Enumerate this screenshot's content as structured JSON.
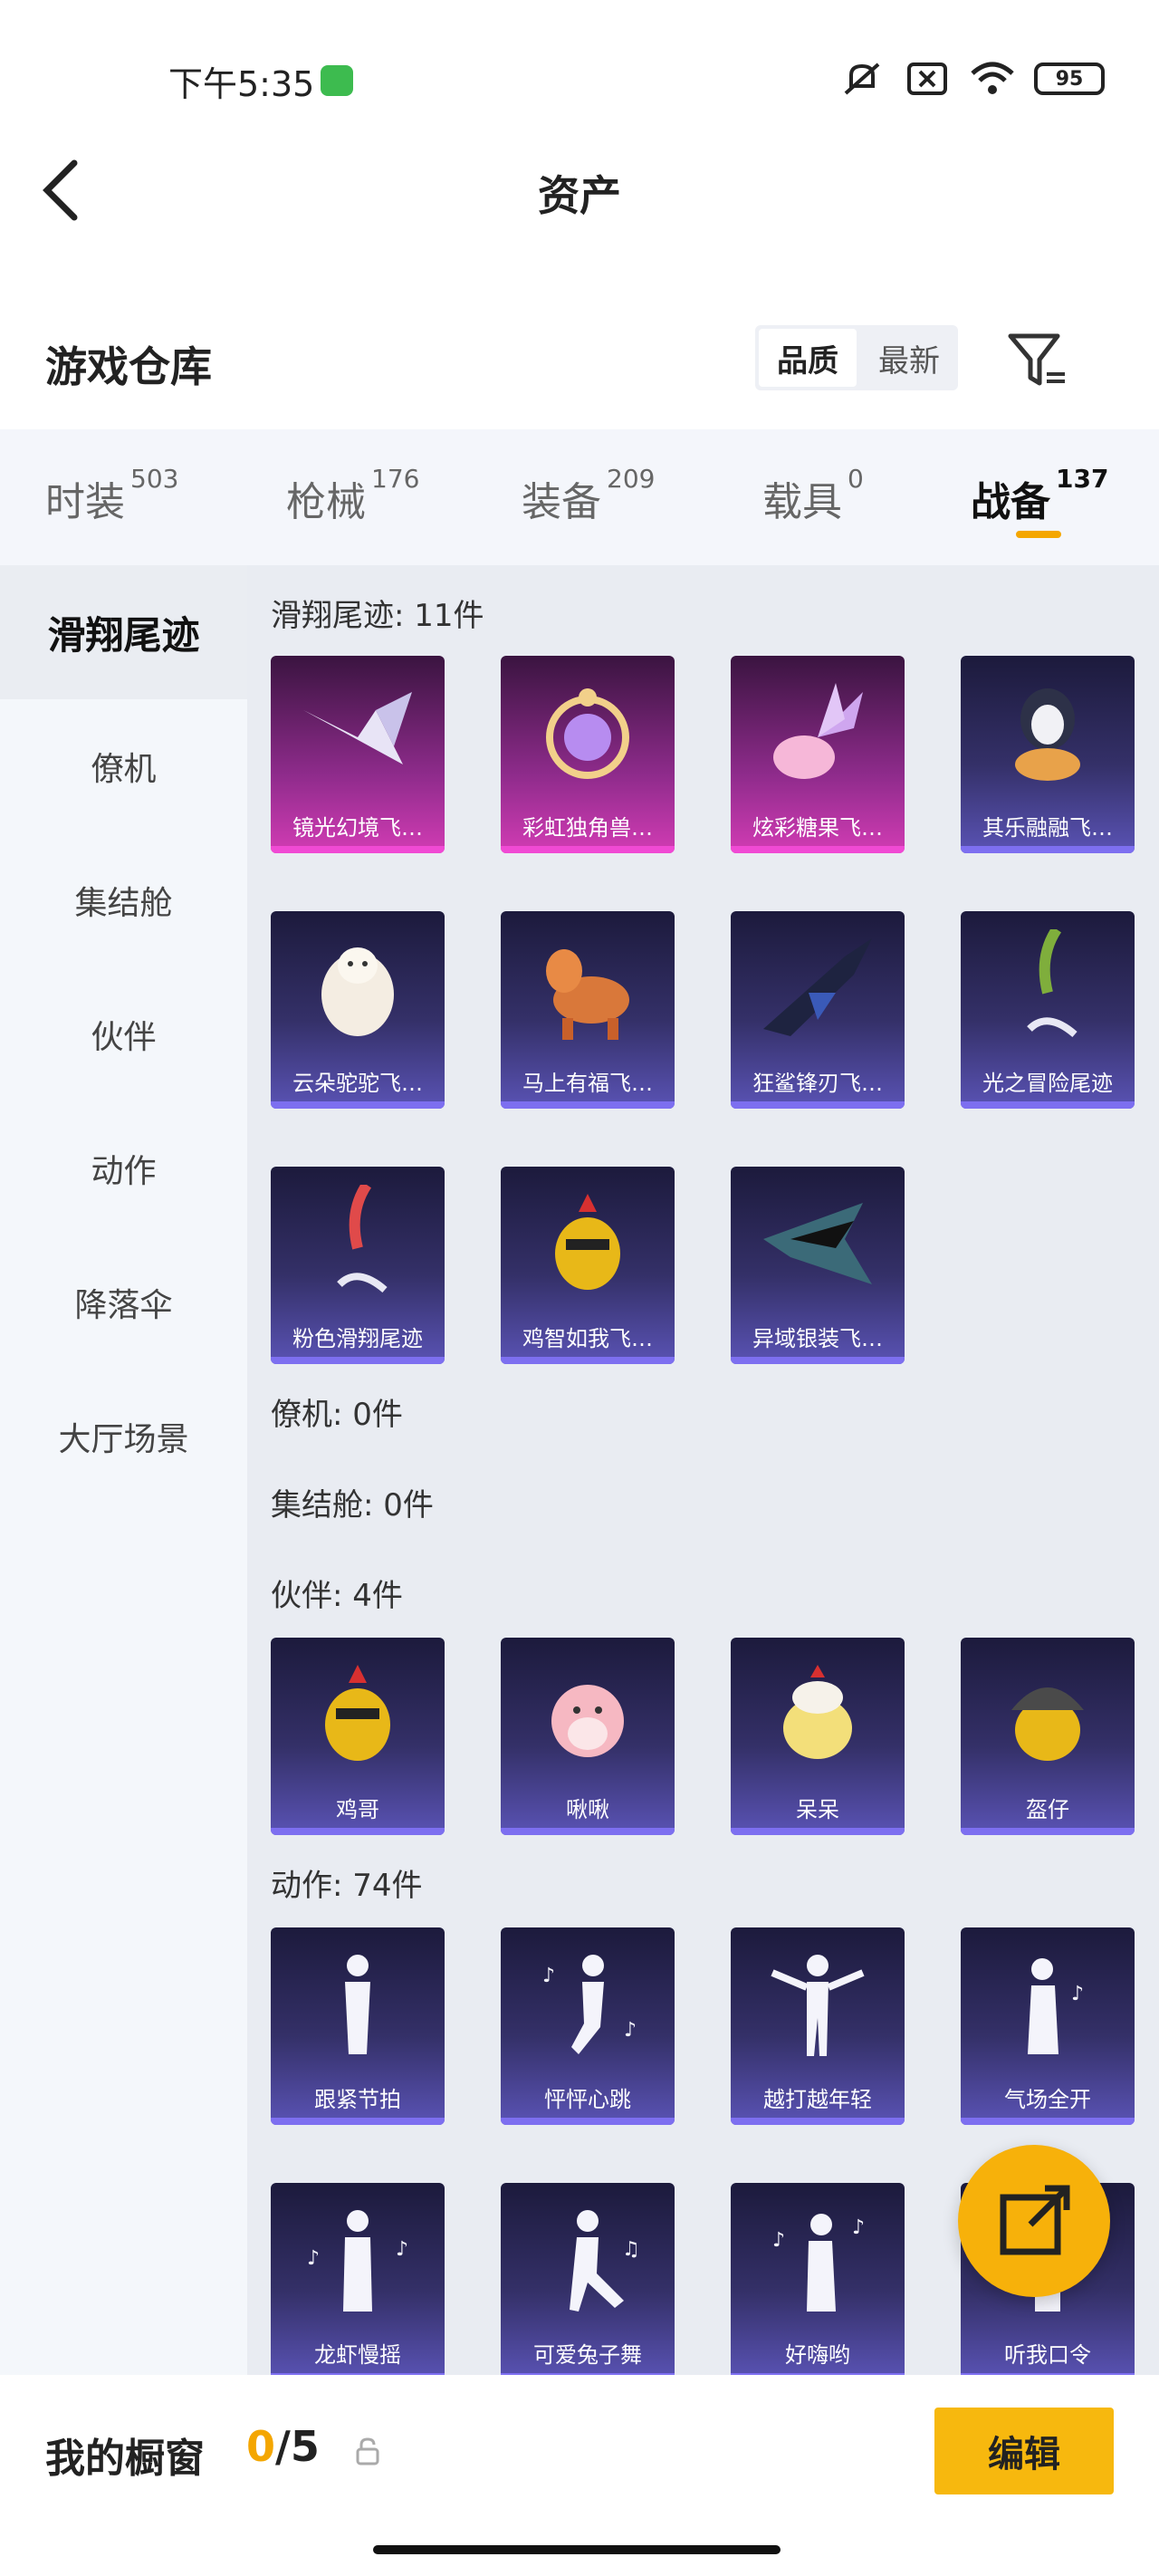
{
  "status": {
    "time": "下午5:35",
    "battery": "95"
  },
  "header": {
    "title": "资产"
  },
  "section": {
    "title": "游戏仓库",
    "sort_options": [
      "品质",
      "最新"
    ]
  },
  "tabs": [
    {
      "label": "时装",
      "count": "503"
    },
    {
      "label": "枪械",
      "count": "176"
    },
    {
      "label": "装备",
      "count": "209"
    },
    {
      "label": "载具",
      "count": "0"
    },
    {
      "label": "战备",
      "count": "137"
    }
  ],
  "sidebar": [
    "滑翔尾迹",
    "僚机",
    "集结舱",
    "伙伴",
    "动作",
    "降落伞",
    "大厅场景"
  ],
  "groups": {
    "glide": {
      "label": "滑翔尾迹: 11件",
      "items": [
        "镜光幻境飞…",
        "彩虹独角兽…",
        "炫彩糖果飞…",
        "其乐融融飞…",
        "云朵驼驼飞…",
        "马上有福飞…",
        "狂鲨锋刃飞…",
        "光之冒险尾迹",
        "粉色滑翔尾迹",
        "鸡智如我飞…",
        "异域银装飞…"
      ]
    },
    "wingman": {
      "label": "僚机: 0件"
    },
    "capsule": {
      "label": "集结舱: 0件"
    },
    "partner": {
      "label": "伙伴: 4件",
      "items": [
        "鸡哥",
        "啾啾",
        "呆呆",
        "盔仔"
      ]
    },
    "action": {
      "label": "动作: 74件",
      "items": [
        "跟紧节拍",
        "怦怦心跳",
        "越打越年轻",
        "气场全开",
        "龙虾慢摇",
        "可爱兔子舞",
        "好嗨哟",
        "听我口令"
      ]
    }
  },
  "footer": {
    "title": "我的橱窗",
    "count_current": "0",
    "count_total": "/5",
    "edit_label": "编辑"
  },
  "colors": {
    "accent": "#f7b80e",
    "card_purple": "#5a53b5",
    "card_pink": "#d23cb4"
  }
}
